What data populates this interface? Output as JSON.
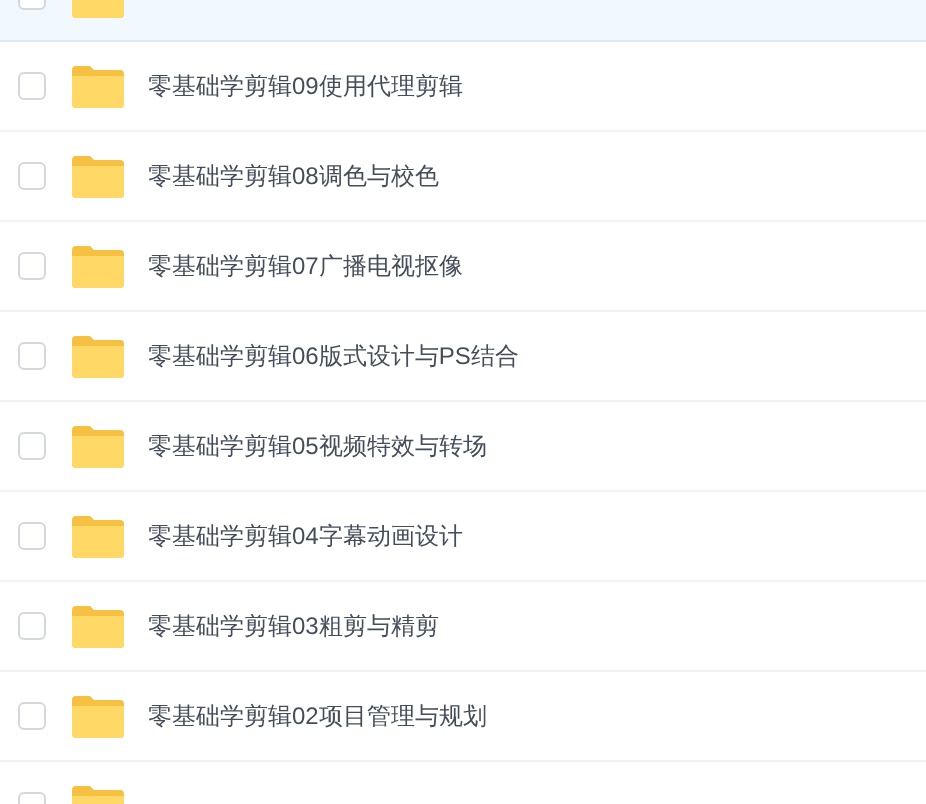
{
  "files": [
    {
      "highlighted": true,
      "checked": false
    },
    {
      "name": "零基础学剪辑09使用代理剪辑",
      "highlighted": false,
      "checked": false
    },
    {
      "name": "零基础学剪辑08调色与校色",
      "highlighted": false,
      "checked": false
    },
    {
      "name": "零基础学剪辑07广播电视抠像",
      "highlighted": false,
      "checked": false
    },
    {
      "name": "零基础学剪辑06版式设计与PS结合",
      "highlighted": false,
      "checked": false
    },
    {
      "name": "零基础学剪辑05视频特效与转场",
      "highlighted": false,
      "checked": false
    },
    {
      "name": "零基础学剪辑04字幕动画设计",
      "highlighted": false,
      "checked": false
    },
    {
      "name": "零基础学剪辑03粗剪与精剪",
      "highlighted": false,
      "checked": false
    },
    {
      "name": "零基础学剪辑02项目管理与规划",
      "highlighted": false,
      "checked": false
    },
    {
      "highlighted": false,
      "checked": false
    }
  ]
}
